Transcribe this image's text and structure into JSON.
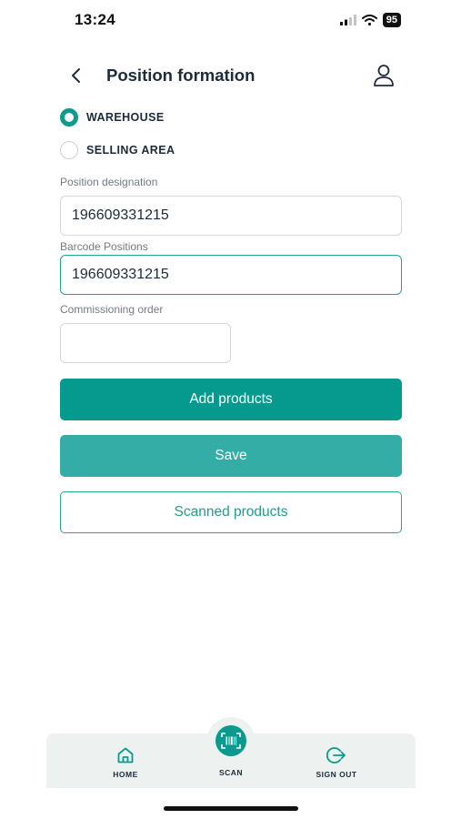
{
  "status_bar": {
    "time": "13:24",
    "battery": "95"
  },
  "header": {
    "title": "Position formation"
  },
  "radios": [
    {
      "label": "WAREHOUSE",
      "selected": true
    },
    {
      "label": "SELLING AREA",
      "selected": false
    }
  ],
  "fields": {
    "position_designation": {
      "label": "Position designation",
      "value": "196609331215"
    },
    "barcode_positions": {
      "label": "Barcode Positions",
      "value": "196609331215"
    },
    "commissioning_order": {
      "label": "Commissioning order",
      "value": ""
    }
  },
  "buttons": {
    "add_products": "Add products",
    "save": "Save",
    "scanned_products": "Scanned products"
  },
  "nav": {
    "home": "HOME",
    "scan": "SCAN",
    "sign_out": "SIGN OUT"
  },
  "colors": {
    "accent": "#069a8e",
    "save": "#33ada6",
    "nav_bg": "#edf2f1"
  },
  "icons": [
    "signal-icon",
    "wifi-icon",
    "battery-icon",
    "back-chevron-icon",
    "profile-icon",
    "home-icon",
    "barcode-scan-icon",
    "sign-out-icon"
  ]
}
